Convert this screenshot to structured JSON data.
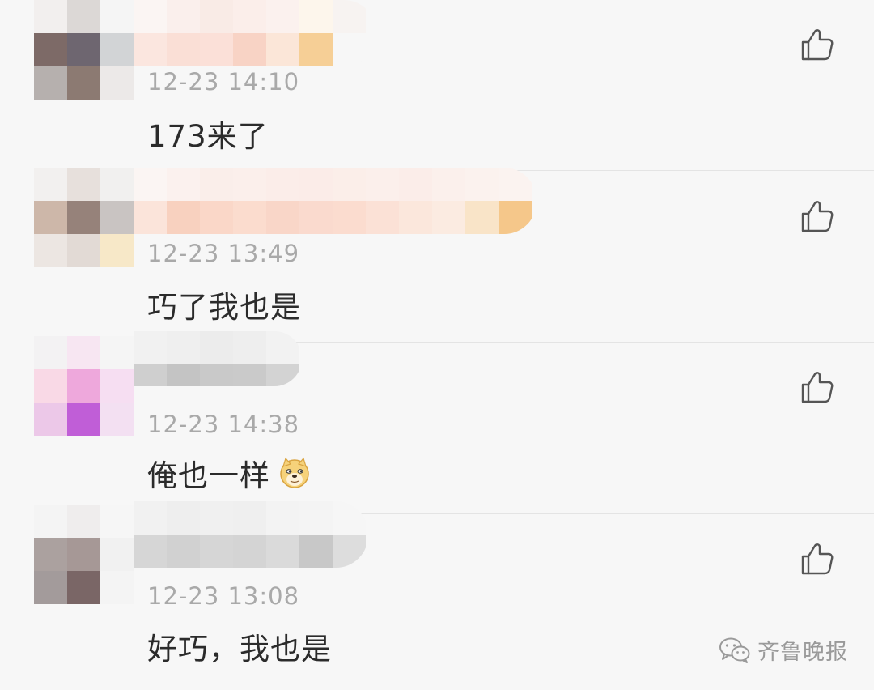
{
  "comments": [
    {
      "time": "12-23 14:10",
      "text": "173来了"
    },
    {
      "time": "12-23 13:49",
      "text": "巧了我也是"
    },
    {
      "time": "12-23 14:38",
      "text": "俺也一样"
    },
    {
      "time": "12-23 13:08",
      "text": "好巧，我也是"
    }
  ],
  "watermark": {
    "label": "齐鲁晚报"
  },
  "icons": {
    "like": "thumbs-up-icon",
    "emoji": "doge-emoji-icon",
    "brand": "wechat-icon"
  },
  "colors": {
    "text": "#2b2b2b",
    "time": "#a9a9a9",
    "divider": "#e4e4e4",
    "background": "#f7f7f7"
  }
}
